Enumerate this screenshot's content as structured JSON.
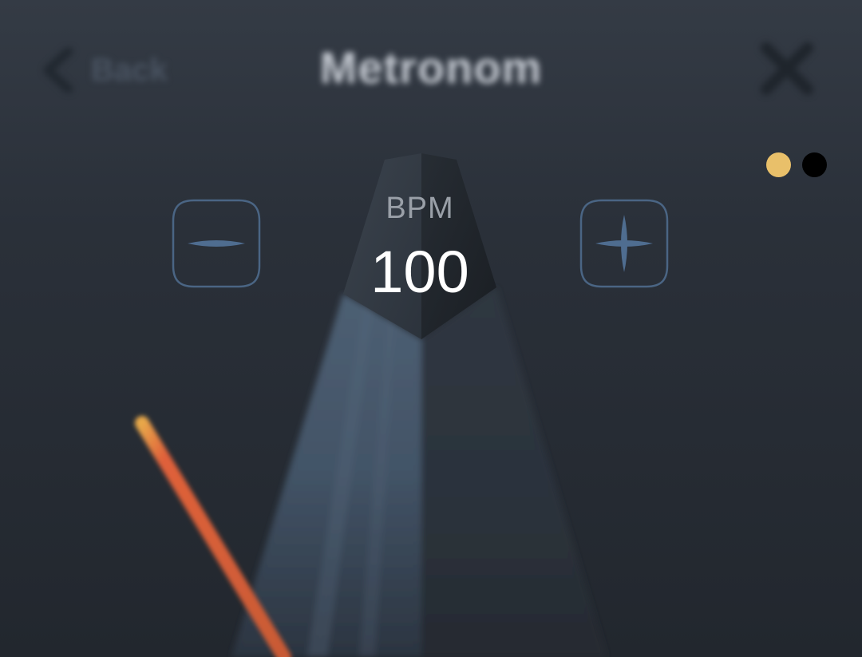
{
  "nav": {
    "back_label": "Back",
    "title": "Metronom",
    "back_icon": "chevron-left-icon",
    "close_icon": "close-icon"
  },
  "pager": {
    "dots": [
      {
        "state": "active",
        "color": "#e9c06a"
      },
      {
        "state": "inactive",
        "color": "#000000"
      }
    ]
  },
  "tempo": {
    "label": "BPM",
    "value": "100",
    "decrease_icon": "minus-icon",
    "increase_icon": "plus-icon"
  },
  "colors": {
    "background": "#2a3039",
    "accent": "#e9c06a",
    "stepper_outline": "#4a6584",
    "stepper_glyph": "#4f6d90",
    "pendulum": "#e0613a"
  }
}
